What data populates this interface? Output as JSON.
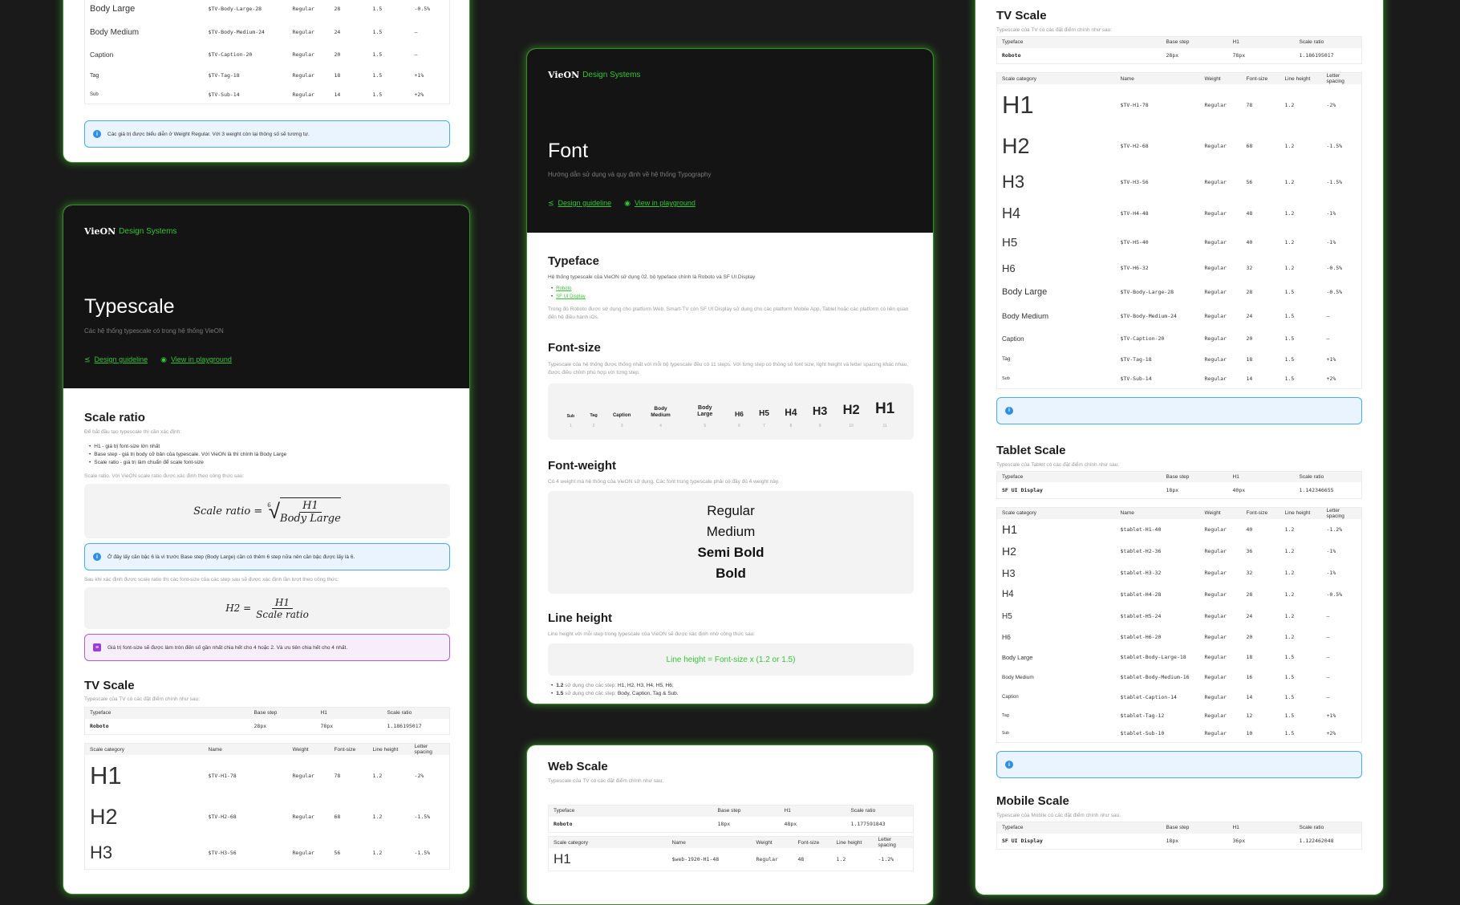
{
  "brand": {
    "logo_text": "VieON",
    "subtitle": "Design Systems",
    "accent": "#37c437"
  },
  "typescale_page": {
    "title": "Typescale",
    "subtitle": "Các hệ thống typescale có trong hệ thống VieON",
    "link_guideline": "Design guideline",
    "link_playground": "View in playground",
    "top_rows": [
      {
        "cat": "Body Large",
        "name": "$TV-Body-Large-28",
        "weight": "Regular",
        "size": "28",
        "lh": "1.5",
        "ls": "-0.5%"
      },
      {
        "cat": "Body Medium",
        "name": "$TV-Body-Medium-24",
        "weight": "Regular",
        "size": "24",
        "lh": "1.5",
        "ls": "–"
      },
      {
        "cat": "Caption",
        "name": "$TV-Caption-20",
        "weight": "Regular",
        "size": "20",
        "lh": "1.5",
        "ls": "–"
      },
      {
        "cat": "Tag",
        "name": "$TV-Tag-18",
        "weight": "Regular",
        "size": "18",
        "lh": "1.5",
        "ls": "+1%"
      },
      {
        "cat": "Sub",
        "name": "$TV-Sub-14",
        "weight": "Regular",
        "size": "14",
        "lh": "1.5",
        "ls": "+2%"
      }
    ],
    "top_callout": "Các giá trị được biểu diễn ở Weight Regular. Với 3 weight còn lại thông số sẽ tương tự.",
    "scale_ratio": {
      "title": "Scale ratio",
      "intro": "Để bắt đầu tạo typescale thì cần xác định:",
      "bullets": [
        "H1 - giá trị font-size lớn nhất",
        "Base step - giá trị body cỡ bản của typescale. Với VieON là thì chính là Body Large",
        "Scale ratio - giá trị làm chuẩn để scale font-size"
      ],
      "formula_note": "Scale ratio. Với VieON scale ratio được xác định theo công thức sau:",
      "formula_lhs": "Scale  ratio =",
      "formula_root": "6",
      "formula_num": "H1",
      "formula_den": "Body Large",
      "callout": "Ở đây lấy căn bậc 6 là vì trước Base step (Body Large) cần có thêm 6 step nữa nên căn bậc được lấy là 6.",
      "after_note": "Sau khi xác định được scale ratio thì các font-size của các step sau sẽ được xác định lần lượt theo công thức:",
      "formula2_lhs": "H2 =",
      "formula2_num": "H1",
      "formula2_den": "Scale  ratio",
      "callout2": "Giá trị font-size sẽ được làm tròn đến số gần nhất chia hết cho 4 hoặc 2. Và ưu tiên chia hết cho 4 nhất."
    },
    "tv_scale": {
      "title": "TV Scale",
      "desc": "Typescale của TV có các đặt điểm chính như sau:",
      "rows": [
        {
          "cat": "H1",
          "name": "$TV-H1-78",
          "weight": "Regular",
          "size": "78",
          "lh": "1.2",
          "ls": "-2%"
        },
        {
          "cat": "H2",
          "name": "$TV-H2-68",
          "weight": "Regular",
          "size": "68",
          "lh": "1.2",
          "ls": "-1.5%"
        },
        {
          "cat": "H3",
          "name": "$TV-H3-56",
          "weight": "Regular",
          "size": "56",
          "lh": "1.2",
          "ls": "-1.5%"
        }
      ]
    }
  },
  "table_headers": {
    "typeface": [
      "Typeface",
      "Base step",
      "H1",
      "Scale ratio"
    ],
    "scale": [
      "Scale category",
      "Name",
      "Weight",
      "Font-size",
      "Line height",
      "Letter spacing"
    ]
  },
  "tv_typeface": {
    "typeface": "Roboto",
    "base": "28px",
    "h1": "78px",
    "ratio": "1.186195017"
  },
  "font_page": {
    "title": "Font",
    "subtitle": "Hướng dẫn sử dụng và quy định về hệ thống Typography",
    "link_guideline": "Design guideline",
    "link_playground": "View in playground",
    "typeface": {
      "title": "Typeface",
      "desc": "Hệ thống typescale của VieON sử dụng 02. bộ typeface chính là Roboto và SF UI Display",
      "links": [
        "Roboto",
        "SF UI Display"
      ],
      "note": "Trong đó Roboto được sử dụng cho platform Web, Smart-TV còn SF UI Display sử dụng cho các platform Mobile App, Tablet hoặc các platform có liên quan đến hệ điều hành iOs."
    },
    "font_size": {
      "title": "Font-size",
      "desc": "Typescale của hệ thống được thống nhất với mỗi bộ typescale đều có 11 steps. Với từng step có thông số font size, light height và letter spacing khác nhau, được điều chỉnh phù hợp với từng step.",
      "steps": [
        {
          "label": "Sub",
          "n": "1"
        },
        {
          "label": "Tag",
          "n": "2"
        },
        {
          "label": "Caption",
          "n": "3"
        },
        {
          "label": "Body Medium",
          "n": "4"
        },
        {
          "label": "Body Large",
          "n": "5"
        },
        {
          "label": "H6",
          "n": "6"
        },
        {
          "label": "H5",
          "n": "7"
        },
        {
          "label": "H4",
          "n": "8"
        },
        {
          "label": "H3",
          "n": "9"
        },
        {
          "label": "H2",
          "n": "10"
        },
        {
          "label": "H1",
          "n": "11"
        }
      ]
    },
    "font_weight": {
      "title": "Font-weight",
      "desc": "Có 4 weight mà hệ thống của VieON sử dụng. Các font trong typescale phải có đầy đủ 4 weight này.",
      "weights": [
        "Regular",
        "Medium",
        "Semi Bold",
        "Bold"
      ]
    },
    "line_height": {
      "title": "Line height",
      "desc": "Line height với mỗi step trong typescale của VieON sẽ được xác định nhờ công thức sau:",
      "formula": "Line height = Font-size x (1.2 or 1.5)",
      "b1_val": "1.2",
      "b1_mid": "sử dụng cho các step:",
      "b1_items": "H1, H2, H3, H4, H5, H6;",
      "b2_val": "1.5",
      "b2_mid": "sử dụng cho các step:",
      "b2_items": "Body, Caption, Tag & Sub."
    }
  },
  "web_scale": {
    "title": "Web Scale",
    "desc": "Typescale của TV có các đặt điểm chính như sau:",
    "typeface": {
      "typeface": "Roboto",
      "base": "18px",
      "h1": "48px",
      "ratio": "1.177591843"
    },
    "rows": [
      {
        "cat": "H1",
        "name": "$web-1920-H1-48",
        "weight": "Regular",
        "size": "48",
        "lh": "1.2",
        "ls": "-1.2%"
      }
    ]
  },
  "right_tv": {
    "title": "TV Scale",
    "desc": "Typescale của TV có các đặt điểm chính như sau:",
    "rows": [
      {
        "cat": "H1",
        "name": "$TV-H1-78",
        "weight": "Regular",
        "size": "78",
        "lh": "1.2",
        "ls": "-2%"
      },
      {
        "cat": "H2",
        "name": "$TV-H2-68",
        "weight": "Regular",
        "size": "68",
        "lh": "1.2",
        "ls": "-1.5%"
      },
      {
        "cat": "H3",
        "name": "$TV-H3-56",
        "weight": "Regular",
        "size": "56",
        "lh": "1.2",
        "ls": "-1.5%"
      },
      {
        "cat": "H4",
        "name": "$TV-H4-48",
        "weight": "Regular",
        "size": "48",
        "lh": "1.2",
        "ls": "-1%"
      },
      {
        "cat": "H5",
        "name": "$TV-H5-40",
        "weight": "Regular",
        "size": "40",
        "lh": "1.2",
        "ls": "-1%"
      },
      {
        "cat": "H6",
        "name": "$TV-H6-32",
        "weight": "Regular",
        "size": "32",
        "lh": "1.2",
        "ls": "-0.5%"
      },
      {
        "cat": "Body Large",
        "name": "$TV-Body-Large-28",
        "weight": "Regular",
        "size": "28",
        "lh": "1.5",
        "ls": "-0.5%"
      },
      {
        "cat": "Body Medium",
        "name": "$TV-Body-Medium-24",
        "weight": "Regular",
        "size": "24",
        "lh": "1.5",
        "ls": "–"
      },
      {
        "cat": "Caption",
        "name": "$TV-Caption-20",
        "weight": "Regular",
        "size": "20",
        "lh": "1.5",
        "ls": "–"
      },
      {
        "cat": "Tag",
        "name": "$TV-Tag-18",
        "weight": "Regular",
        "size": "18",
        "lh": "1.5",
        "ls": "+1%"
      },
      {
        "cat": "Sub",
        "name": "$TV-Sub-14",
        "weight": "Regular",
        "size": "14",
        "lh": "1.5",
        "ls": "+2%"
      }
    ]
  },
  "tablet": {
    "title": "Tablet Scale",
    "desc": "Typescale của Tablet có các đặt điểm chính như sau:",
    "typeface": {
      "typeface": "SF UI Display",
      "base": "18px",
      "h1": "40px",
      "ratio": "1.142346655"
    },
    "rows": [
      {
        "cat": "H1",
        "name": "$tablet-H1-40",
        "weight": "Regular",
        "size": "40",
        "lh": "1.2",
        "ls": "-1.2%"
      },
      {
        "cat": "H2",
        "name": "$tablet-H2-36",
        "weight": "Regular",
        "size": "36",
        "lh": "1.2",
        "ls": "-1%"
      },
      {
        "cat": "H3",
        "name": "$tablet-H3-32",
        "weight": "Regular",
        "size": "32",
        "lh": "1.2",
        "ls": "-1%"
      },
      {
        "cat": "H4",
        "name": "$tablet-H4-28",
        "weight": "Regular",
        "size": "28",
        "lh": "1.2",
        "ls": "-0.5%"
      },
      {
        "cat": "H5",
        "name": "$tablet-H5-24",
        "weight": "Regular",
        "size": "24",
        "lh": "1.2",
        "ls": "–"
      },
      {
        "cat": "H6",
        "name": "$tablet-H6-20",
        "weight": "Regular",
        "size": "20",
        "lh": "1.2",
        "ls": "–"
      },
      {
        "cat": "Body Large",
        "name": "$tablet-Body-Large-18",
        "weight": "Regular",
        "size": "18",
        "lh": "1.5",
        "ls": "–"
      },
      {
        "cat": "Body Medium",
        "name": "$tablet-Body-Medium-16",
        "weight": "Regular",
        "size": "16",
        "lh": "1.5",
        "ls": "–"
      },
      {
        "cat": "Caption",
        "name": "$tablet-Caption-14",
        "weight": "Regular",
        "size": "14",
        "lh": "1.5",
        "ls": "–"
      },
      {
        "cat": "Tag",
        "name": "$tablet-Tag-12",
        "weight": "Regular",
        "size": "12",
        "lh": "1.5",
        "ls": "+1%"
      },
      {
        "cat": "Sub",
        "name": "$tablet-Sub-10",
        "weight": "Regular",
        "size": "10",
        "lh": "1.5",
        "ls": "+2%"
      }
    ]
  },
  "mobile": {
    "title": "Mobile Scale",
    "desc": "Typescale của Mobile có các đặt điểm chính như sau:",
    "typeface": {
      "typeface": "SF UI Display",
      "base": "18px",
      "h1": "36px",
      "ratio": "1.122462048"
    }
  }
}
